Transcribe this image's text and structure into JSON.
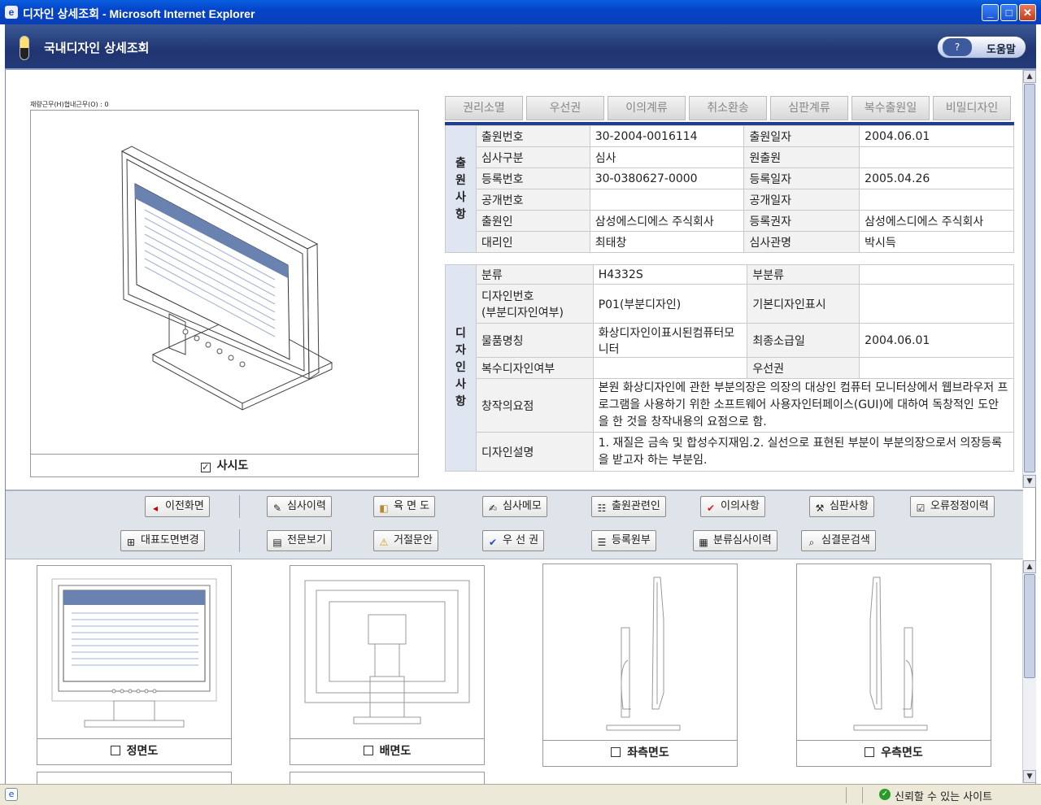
{
  "window": {
    "title": "디자인 상세조회 - Microsoft Internet Explorer",
    "minimize": "_",
    "maximize": "□",
    "close": "✕"
  },
  "header": {
    "title": "국내디자인 상세조회",
    "help_label": "도움말"
  },
  "main_image": {
    "mini_caption": "재량근무(H)협내근무(O) : 0",
    "caption": "사시도",
    "checked": true
  },
  "tabs": [
    "권리소멸",
    "우선권",
    "이의계류",
    "취소환송",
    "심판계류",
    "복수출원일",
    "비밀디자인"
  ],
  "application_section": {
    "heading": "출원사항",
    "rows": [
      {
        "l1": "출원번호",
        "v1": "30-2004-0016114",
        "l2": "출원일자",
        "v2": "2004.06.01"
      },
      {
        "l1": "심사구분",
        "v1": "심사",
        "l2": "원출원",
        "v2": ""
      },
      {
        "l1": "등록번호",
        "v1": "30-0380627-0000",
        "l2": "등록일자",
        "v2": "2005.04.26"
      },
      {
        "l1": "공개번호",
        "v1": "",
        "l2": "공개일자",
        "v2": ""
      },
      {
        "l1": "출원인",
        "v1": "삼성에스디에스 주식회사",
        "l2": "등록권자",
        "v2": "삼성에스디에스 주식회사"
      },
      {
        "l1": "대리인",
        "v1": "최태창",
        "l2": "심사관명",
        "v2": "박시득"
      }
    ]
  },
  "design_section": {
    "heading": "디자인사항",
    "classification_label": "분류",
    "classification": "H4332S",
    "subclass_label": "부분류",
    "subclass": "",
    "design_no_label": "디자인번호\n(부분디자인여부)",
    "design_no": "P01(부분디자인)",
    "basic_design_label": "기본디자인표시",
    "basic_design": "",
    "article_label": "물품명칭",
    "article": "화상디자인이표시된컴퓨터모니터",
    "final_date_label": "최종소급일",
    "final_date": "2004.06.01",
    "multi_label": "복수디자인여부",
    "multi": "",
    "priority_label": "우선권",
    "priority": "",
    "gist_label": "창작의요점",
    "gist": "본원 화상디자인에 관한 부분의장은 의장의 대상인 컴퓨터 모니터상에서 웹브라우저 프로그램을 사용하기 위한 소프트웨어 사용자인터페이스(GUI)에 대하여 독창적인 도안을 한 것을 창작내용의 요점으로 함.",
    "desc_label": "디자인설명",
    "desc": "1. 재질은 금속 및 합성수지재임.2. 실선으로 표현된 부분이 부분의장으로서 의장등록을 받고자 하는 부분임."
  },
  "toolbar": {
    "row1": [
      {
        "label": "이전화면",
        "icon": "back-arrow-icon"
      },
      {
        "label": "심사이력",
        "icon": "review-history-icon"
      },
      {
        "label": "육 면 도",
        "icon": "cube-icon"
      },
      {
        "label": "심사메모",
        "icon": "memo-icon"
      },
      {
        "label": "출원관련인",
        "icon": "people-icon"
      },
      {
        "label": "이의사항",
        "icon": "checkmark-icon"
      },
      {
        "label": "심판사항",
        "icon": "gavel-icon"
      },
      {
        "label": "오류정정이력",
        "icon": "correction-icon"
      }
    ],
    "row2": [
      {
        "label": "대표도면변경",
        "icon": "drawing-change-icon"
      },
      {
        "label": "전문보기",
        "icon": "full-text-icon"
      },
      {
        "label": "거절문안",
        "icon": "warning-icon"
      },
      {
        "label": "우 선 권",
        "icon": "checkmark-icon"
      },
      {
        "label": "등록원부",
        "icon": "register-icon"
      },
      {
        "label": "분류심사이력",
        "icon": "class-history-icon"
      },
      {
        "label": "심결문검색",
        "icon": "search-icon"
      }
    ]
  },
  "thumbnails": [
    {
      "caption": "정면도",
      "checked": false
    },
    {
      "caption": "배면도",
      "checked": false
    },
    {
      "caption": "좌측면도",
      "checked": false
    },
    {
      "caption": "우측면도",
      "checked": false
    }
  ],
  "status": {
    "zone": "신뢰할 수 있는 사이트"
  }
}
